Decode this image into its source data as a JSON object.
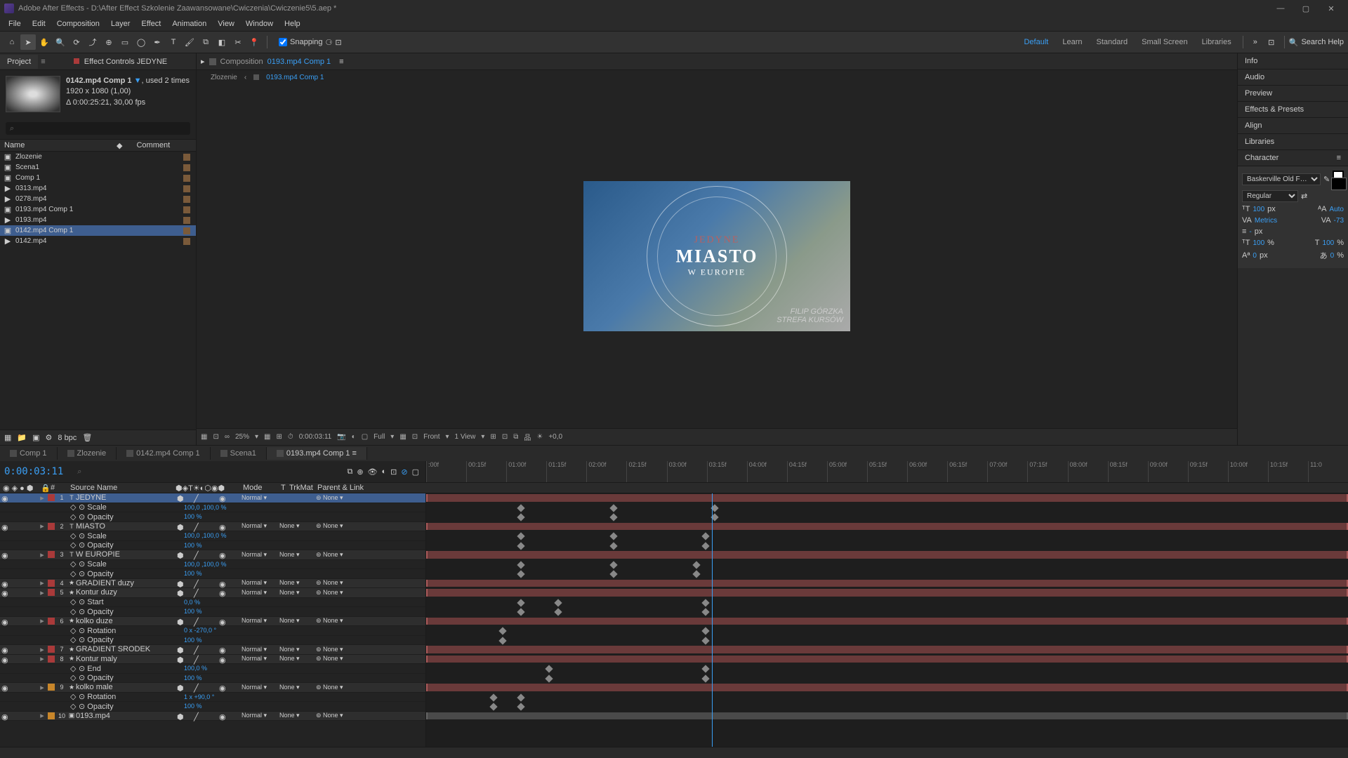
{
  "titlebar": {
    "title": "Adobe After Effects - D:\\After Effect Szkolenie Zaawansowane\\Cwiczenia\\Cwiczenie5\\5.aep *"
  },
  "menu": [
    "File",
    "Edit",
    "Composition",
    "Layer",
    "Effect",
    "Animation",
    "View",
    "Window",
    "Help"
  ],
  "toolbar": {
    "snapping": "Snapping",
    "workspaces": [
      "Default",
      "Learn",
      "Standard",
      "Small Screen",
      "Libraries"
    ],
    "search_placeholder": "Search Help"
  },
  "project": {
    "tab_project": "Project",
    "tab_effects": "Effect Controls JEDYNE",
    "item_name": "0142.mp4 Comp 1",
    "item_used": ", used 2 times",
    "item_dims": "1920 x 1080 (1,00)",
    "item_dur": "Δ 0:00:25:21, 30,00 fps",
    "col_name": "Name",
    "col_comment": "Comment",
    "items": [
      {
        "name": "Zlozenie",
        "icon": "comp"
      },
      {
        "name": "Scena1",
        "icon": "comp"
      },
      {
        "name": "Comp 1",
        "icon": "comp"
      },
      {
        "name": "0313.mp4",
        "icon": "vid"
      },
      {
        "name": "0278.mp4",
        "icon": "vid"
      },
      {
        "name": "0193.mp4 Comp 1",
        "icon": "comp"
      },
      {
        "name": "0193.mp4",
        "icon": "vid"
      },
      {
        "name": "0142.mp4 Comp 1",
        "icon": "comp",
        "sel": true
      },
      {
        "name": "0142.mp4",
        "icon": "vid"
      }
    ],
    "bpc": "8 bpc"
  },
  "comp": {
    "tab_prefix": "Composition",
    "tab_name": "0193.mp4 Comp 1",
    "breadcrumb": [
      "Zlozenie",
      "0193.mp4 Comp 1"
    ],
    "text1": "JEDYNE",
    "text2": "MIASTO",
    "text3": "W EUROPIE",
    "credit1": "FILIP  GÓRZKA",
    "credit2": "STREFA KURSÓW",
    "zoom": "25%",
    "timecode": "0:00:03:11",
    "res": "Full",
    "view3d": "Front",
    "views": "1 View",
    "exposure": "+0,0"
  },
  "right": {
    "panels": [
      "Info",
      "Audio",
      "Preview",
      "Effects & Presets",
      "Align",
      "Libraries"
    ],
    "char_title": "Character",
    "font": "Baskerville Old F…",
    "style": "Regular",
    "size": "100",
    "size_unit": "px",
    "leading": "Auto",
    "kerning": "Metrics",
    "tracking": "-73",
    "vscale": "100",
    "hscale": "100",
    "baseline": "0",
    "tsume": "0"
  },
  "timeline": {
    "tabs": [
      "Comp 1",
      "Zlozenie",
      "0142.mp4 Comp 1",
      "Scena1",
      "0193.mp4 Comp 1"
    ],
    "active_tab": 4,
    "time": "0:00:03:11",
    "ruler": [
      ":00f",
      "00:15f",
      "01:00f",
      "01:15f",
      "02:00f",
      "02:15f",
      "03:00f",
      "03:15f",
      "04:00f",
      "04:15f",
      "05:00f",
      "05:15f",
      "06:00f",
      "06:15f",
      "07:00f",
      "07:15f",
      "08:00f",
      "08:15f",
      "09:00f",
      "09:15f",
      "10:00f",
      "10:15f",
      "11:0"
    ],
    "col_source": "Source Name",
    "col_mode": "Mode",
    "col_trk": "TrkMat",
    "col_parent": "Parent & Link",
    "mode_normal": "Normal",
    "none": "None",
    "layers": [
      {
        "n": 1,
        "name": "JEDYNE",
        "type": "T",
        "sel": true,
        "props": [
          {
            "p": "Scale",
            "v": "100,0 ,100,0 %"
          },
          {
            "p": "Opacity",
            "v": "100 %"
          }
        ],
        "kf": [
          10,
          20,
          31
        ]
      },
      {
        "n": 2,
        "name": "MIASTO",
        "type": "T",
        "props": [
          {
            "p": "Scale",
            "v": "100,0 ,100,0 %"
          },
          {
            "p": "Opacity",
            "v": "100 %"
          }
        ],
        "kf": [
          10,
          20,
          30
        ]
      },
      {
        "n": 3,
        "name": "W EUROPIE",
        "type": "T",
        "props": [
          {
            "p": "Scale",
            "v": "100,0 ,100,0 %"
          },
          {
            "p": "Opacity",
            "v": "100 %"
          }
        ],
        "kf": [
          10,
          20,
          29
        ]
      },
      {
        "n": 4,
        "name": "GRADIENT duzy",
        "type": "★",
        "props": []
      },
      {
        "n": 5,
        "name": "Kontur duzy",
        "type": "★",
        "props": [
          {
            "p": "Start",
            "v": "0,0 %"
          },
          {
            "p": "Opacity",
            "v": "100 %"
          }
        ],
        "kf": [
          10,
          14,
          30
        ]
      },
      {
        "n": 6,
        "name": "kolko duze",
        "type": "★",
        "props": [
          {
            "p": "Rotation",
            "v": "0 x -270,0 °"
          },
          {
            "p": "Opacity",
            "v": "100 %"
          }
        ],
        "kf": [
          8,
          30
        ]
      },
      {
        "n": 7,
        "name": "GRADIENT SRODEK",
        "type": "★",
        "props": []
      },
      {
        "n": 8,
        "name": "Kontur maly",
        "type": "★",
        "props": [
          {
            "p": "End",
            "v": "100,0 %"
          },
          {
            "p": "Opacity",
            "v": "100 %"
          }
        ],
        "kf": [
          13,
          30
        ]
      },
      {
        "n": 9,
        "name": "kolko male",
        "type": "★",
        "color": "orange",
        "props": [
          {
            "p": "Rotation",
            "v": "1 x +90,0 °"
          },
          {
            "p": "Opacity",
            "v": "100 %"
          }
        ],
        "kf": [
          7,
          10
        ]
      },
      {
        "n": 10,
        "name": "0193.mp4",
        "type": "▣",
        "color": "orange",
        "props": []
      }
    ]
  }
}
